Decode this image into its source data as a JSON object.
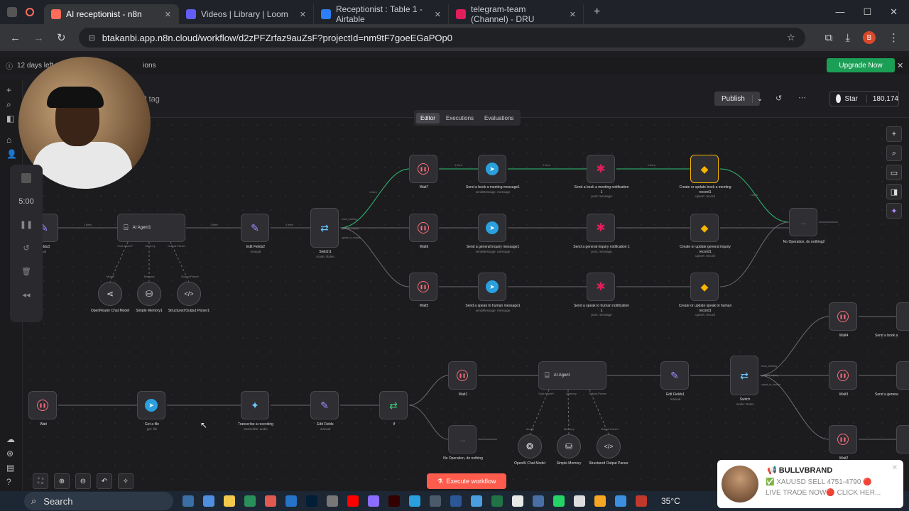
{
  "browser": {
    "tabs": [
      {
        "title": "AI receptionist - n8n",
        "color": "#ff6d5a",
        "active": true
      },
      {
        "title": "Videos | Library | Loom",
        "color": "#625df5"
      },
      {
        "title": "Receptionist : Table 1 - Airtable",
        "color": "#2d7ff9"
      },
      {
        "title": "telegram-team (Channel) - DRU",
        "color": "#e01e5a"
      }
    ],
    "url": "btakanbi.app.n8n.cloud/workflow/d2zPFZrfaz9auZsF?projectId=nm9tF7goeEGaPOp0",
    "profile_initial": "B"
  },
  "banner": {
    "trial_text": "12 days left",
    "trial_suffix": "ions",
    "upgrade_label": "Upgrade Now"
  },
  "header": {
    "tag_text": "ld tag",
    "publish_label": "Publish",
    "star_label": "Star",
    "star_count": "180,174"
  },
  "editor_tabs": [
    "Editor",
    "Executions",
    "Evaluations"
  ],
  "recorder": {
    "time": "5:00"
  },
  "nodes": {
    "fields3": {
      "label": "Fields3",
      "sub": "ual"
    },
    "agent1": {
      "label": "AI Agent1",
      "p1": "Chat Model*",
      "p2": "Memory",
      "p3": "Output Parser"
    },
    "edit2": {
      "label": "Edit Fields2",
      "sub": "manual"
    },
    "switch1": {
      "label": "Switch1",
      "sub": "mode: Rules",
      "o1": "book_meeting",
      "o2": "general_inquiry",
      "o3": "speak_to_human"
    },
    "wait7": {
      "label": "Wait7"
    },
    "wait6": {
      "label": "Wait6"
    },
    "wait5": {
      "label": "Wait5"
    },
    "tg1": {
      "label": "Send a book a meeting message1",
      "sub": "sendMessage: message"
    },
    "tg2": {
      "label": "Send a general inquiry message1",
      "sub": "sendMessage: message"
    },
    "tg3": {
      "label": "Send a speak to human message1",
      "sub": "sendMessage: message"
    },
    "sl1": {
      "label": "Send a book a meeting notification 1",
      "sub": "post: message"
    },
    "sl2": {
      "label": "Send a general inquiry notification 1",
      "sub": "post: message"
    },
    "sl3": {
      "label": "Send a speak to human notification 1",
      "sub": "post: message"
    },
    "at1": {
      "label": "Create or update book a meeting record1",
      "sub": "upsert: record"
    },
    "at2": {
      "label": "Create or update general inquiry record1",
      "sub": "upsert: record"
    },
    "at3": {
      "label": "Create or update speak to human record1",
      "sub": "upsert: record"
    },
    "noop2": {
      "label": "No Operation, do nothing2"
    },
    "openrouter": {
      "label": "OpenRouter Chat Model",
      "tag": "Model"
    },
    "mem1": {
      "label": "Simple Memory1",
      "tag": "Memory"
    },
    "parser1": {
      "label": "Structured Output Parser1",
      "tag": "Output Parser"
    },
    "wait": {
      "label": "Wait"
    },
    "getfile": {
      "label": "Get a file",
      "sub": "get: file"
    },
    "transcribe": {
      "label": "Transcribe a recording",
      "sub": "transcribe: audio"
    },
    "editf": {
      "label": "Edit Fields",
      "sub": "manual"
    },
    "if": {
      "label": "If"
    },
    "wait1": {
      "label": "Wait1"
    },
    "noop": {
      "label": "No Operation, do nothing"
    },
    "agent": {
      "label": "AI Agent",
      "p1": "Chat Model*",
      "p2": "Memory",
      "p3": "Output Parser"
    },
    "editf1": {
      "label": "Edit Fields1",
      "sub": "manual"
    },
    "switch": {
      "label": "Switch",
      "sub": "mode: Rules",
      "o1": "book_meeting",
      "o2": "general_inquiry",
      "o3": "speak_to_human"
    },
    "wait4": {
      "label": "Wait4"
    },
    "wait3": {
      "label": "Wait3"
    },
    "wait2": {
      "label": "Wait2"
    },
    "tgb1": {
      "label": "Send a book a"
    },
    "tgb2": {
      "label": "Send a genera"
    },
    "tgb3": {
      "label": "Send a speak"
    },
    "openai": {
      "label": "OpenAI Chat Model",
      "tag": "Model"
    },
    "mem": {
      "label": "Simple Memory",
      "tag": "Memory"
    },
    "parser": {
      "label": "Structured Output Parser",
      "tag": "Output Parser"
    }
  },
  "edge_labels": {
    "one_item": "1 item"
  },
  "execute_label": "Execute workflow",
  "taskbar": {
    "search": "Search",
    "temp": "35°C"
  },
  "promo": {
    "title": "📢 BULLVBRAND",
    "line1": "✅ XAUUSD SELL 4751-4790 🔴",
    "line2": "LIVE TRADE NOW🔴  CLICK HER..."
  }
}
